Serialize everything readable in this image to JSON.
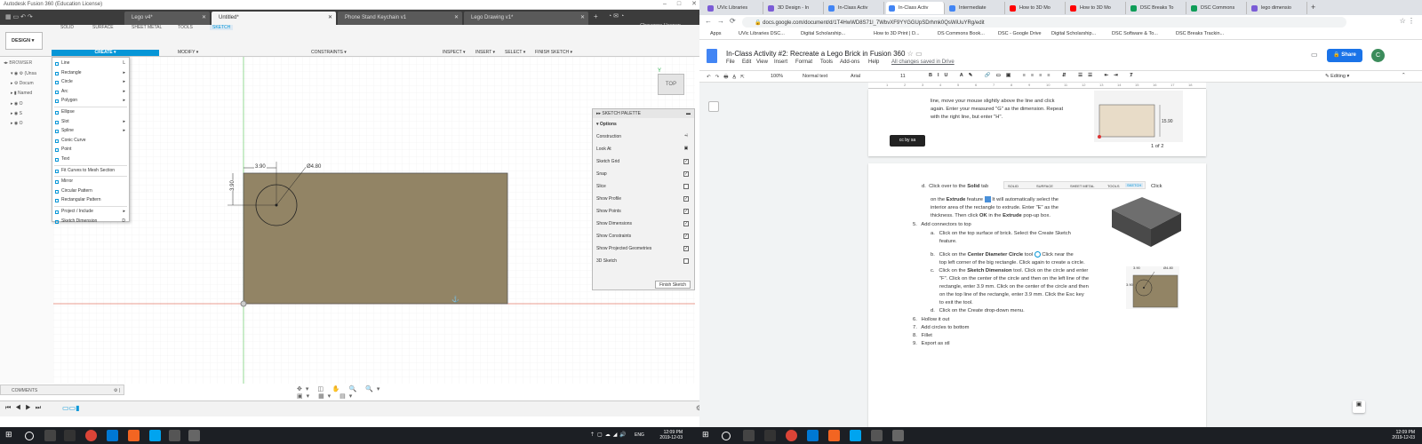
{
  "fusion": {
    "window_title": "Autodesk Fusion 360 (Education License)",
    "tabs": [
      {
        "label": "Lego v4*",
        "active": false
      },
      {
        "label": "Untitled*",
        "active": true
      },
      {
        "label": "Phone Stand Keychain v1",
        "active": false
      },
      {
        "label": "Lego Drawing v1*",
        "active": false
      }
    ],
    "user": "Cheyenne Heenan",
    "workspace": "DESIGN ▾",
    "toolbar_tabs": [
      "SOLID",
      "SURFACE",
      "SHEET METAL",
      "TOOLS",
      "SKETCH"
    ],
    "groups": {
      "create": "CREATE ▾",
      "modify": "MODIFY ▾",
      "constraints": "CONSTRAINTS ▾",
      "inspect": "INSPECT ▾",
      "insert": "INSERT ▾",
      "select": "SELECT ▾",
      "finish": "FINISH SKETCH ▾"
    },
    "browser": {
      "label": "BROWSER",
      "rows": [
        "(Unsa",
        "Docum",
        "Named",
        "O",
        "S",
        "O"
      ]
    },
    "create_menu": [
      {
        "label": "Line",
        "shortcut": "L"
      },
      {
        "label": "Rectangle",
        "sub": true
      },
      {
        "label": "Circle",
        "sub": true
      },
      {
        "label": "Arc",
        "sub": true
      },
      {
        "label": "Polygon",
        "sub": true
      },
      {
        "label": "Ellipse"
      },
      {
        "label": "Slot",
        "sub": true
      },
      {
        "label": "Spline",
        "sub": true
      },
      {
        "label": "Conic Curve"
      },
      {
        "label": "Point"
      },
      {
        "label": "Text"
      },
      {
        "label": "Fit Curves to Mesh Section"
      },
      {
        "label": "Mirror"
      },
      {
        "label": "Circular Pattern"
      },
      {
        "label": "Rectangular Pattern"
      },
      {
        "label": "Project / Include",
        "sub": true
      },
      {
        "label": "Sketch Dimension",
        "shortcut": "D"
      }
    ],
    "palette": {
      "title": "SKETCH PALETTE",
      "section": "Options",
      "rows": [
        {
          "label": "Construction",
          "checked": null
        },
        {
          "label": "Look At",
          "checked": null
        },
        {
          "label": "Sketch Grid",
          "checked": true
        },
        {
          "label": "Snap",
          "checked": true
        },
        {
          "label": "Slice",
          "checked": false
        },
        {
          "label": "Show Profile",
          "checked": true
        },
        {
          "label": "Show Points",
          "checked": true
        },
        {
          "label": "Show Dimensions",
          "checked": true
        },
        {
          "label": "Show Constraints",
          "checked": true
        },
        {
          "label": "Show Projected Geometries",
          "checked": true
        },
        {
          "label": "3D Sketch",
          "checked": false
        }
      ],
      "finish": "Finish Sketch"
    },
    "dims": {
      "horizontal": "3.90",
      "vertical": "3.90",
      "diameter": "Ø4.80"
    },
    "viewcube": "TOP",
    "comments": "COMMENTS"
  },
  "docs": {
    "tabs": [
      "UVic Libraries",
      "3D Design - In",
      "In-Class Activ",
      "In-Class Activ",
      "Intermediate",
      "How to 3D Mo",
      "How to 3D Mo",
      "DSC Breaks To",
      "DSC Commons",
      "lego dimensio"
    ],
    "active_tab": 3,
    "url": "docs.google.com/document/d/1T4HwWD8S71l_7WbvXF9YYGGUpSDrhmk0QsWiUuYRg/edit",
    "bookmarks": [
      "Apps",
      "UVic Libraries DSC...",
      "Digital Scholarship...",
      "How to 3D Print | D...",
      "DS Commons Book...",
      "DSC - Google Drive",
      "Digital Scholarship...",
      "DSC Software & To...",
      "DSC Breaks Trackin..."
    ],
    "title": "In-Class Activity #2: Recreate a Lego Brick in Fusion 360",
    "menus": [
      "File",
      "Edit",
      "View",
      "Insert",
      "Format",
      "Tools",
      "Add-ons",
      "Help"
    ],
    "saved": "All changes saved in Drive",
    "share": "Share",
    "toolbar": {
      "zoom": "100%",
      "style": "Normal text",
      "font": "Arial",
      "size": "11",
      "mode": "Editing"
    },
    "page1": {
      "lines": [
        "line, move your mouse slightly above the line and click",
        "again. Enter your measured \"G\" as the dimension. Repeat",
        "with the right line, but enter \"H\"."
      ],
      "footer": "1 of 2",
      "cc": "cc by sa"
    },
    "page2": {
      "d_prefix": "d.",
      "d_line1a": "Click over to the",
      "d_solid": "Solid",
      "d_line1b": "tab",
      "d_line1c": "Click",
      "mini_tabs": [
        "SOLID",
        "SURFACE",
        "SHEET METAL",
        "TOOLS",
        "SKETCH"
      ],
      "d_line2a": "on the",
      "d_extrude": "Extrude",
      "d_line2b": "feature",
      "d_line2c": "It will automatically select the",
      "d_line3": "interior area of the rectangle to extrude. Enter \"E\" as the",
      "d_line4a": "thickness. Then click",
      "d_ok": "OK",
      "d_line4b": "in the",
      "d_extrude2": "Extrude",
      "d_line4c": "pop-up box.",
      "item5": "Add connectors to top",
      "a_text1": "Click on the top surface of brick. Select the Create Sketch",
      "a_text2": "feature.",
      "b_text1a": "Click on the",
      "b_cdc": "Center Diameter Circle",
      "b_text1b": "tool",
      "b_text1c": "Click near the",
      "b_text2": "top left corner of the big rectangle. Click again to create a circle.",
      "c_text1a": "Click on the",
      "c_sd": "Sketch Dimension",
      "c_text1b": "tool. Click on the circle and enter",
      "c_text2": "\"F\". Click on the center of the circle and then on the left line of the",
      "c_text3": "rectangle, enter 3.9 mm. Click on the center of the circle and then",
      "c_text4": "on the top line of the rectangle, enter 3.9 mm. Click the Esc key",
      "c_text5": "to exit the tool.",
      "d2_text": "Click on the Create drop-down menu.",
      "items": [
        "Hollow it out",
        "Add circles to bottom",
        "Fillet",
        "Export as stl"
      ],
      "img_dims": {
        "d": "Ø4.80",
        "h": "3.90",
        "v": "3.90"
      }
    }
  },
  "taskbar": {
    "time_left": "12:09 PM",
    "date_left": "2019-12-03",
    "time_right": "12:09 PM",
    "date_right": "2019-12-03",
    "lang": "ENG"
  }
}
